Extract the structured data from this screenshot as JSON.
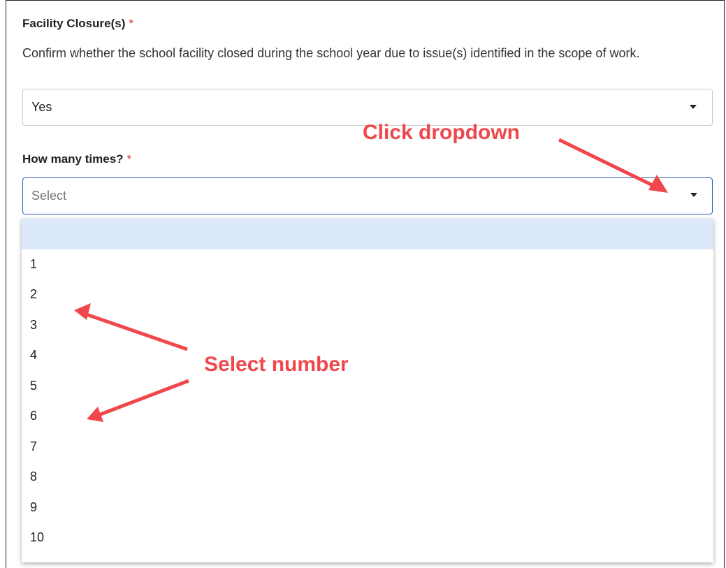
{
  "form": {
    "facility_closure": {
      "label": "Facility Closure(s)",
      "required_mark": "*",
      "help_text": "Confirm whether the school facility closed during the school year due to issue(s) identified in the scope of work.",
      "selected_value": "Yes"
    },
    "how_many_times": {
      "label": "How many times?",
      "required_mark": "*",
      "placeholder": "Select",
      "options": [
        "",
        "1",
        "2",
        "3",
        "4",
        "5",
        "6",
        "7",
        "8",
        "9",
        "10"
      ]
    }
  },
  "annotations": {
    "click_dropdown": "Click dropdown",
    "select_number": "Select number",
    "color": "#f0474c"
  },
  "colors": {
    "focus_border": "#2b5fb4",
    "highlight_option": "#dce9fb",
    "required": "#d32f2f"
  }
}
